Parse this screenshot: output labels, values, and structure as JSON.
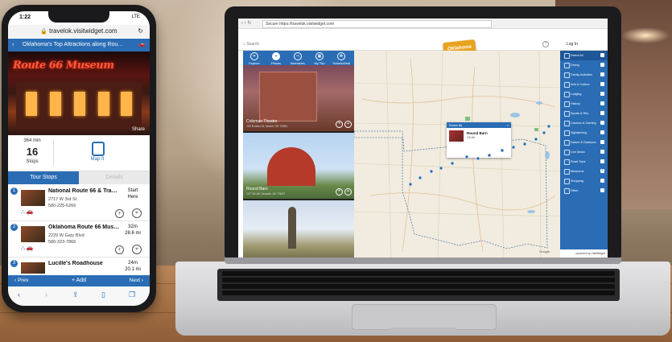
{
  "phone": {
    "status": {
      "time": "1:22",
      "network": "LTE"
    },
    "url": "travelok.visitwidget.com",
    "header_title": "Oklahoma's Top Attractions along Rou…",
    "hero_sign": "Route 66 Museum",
    "hero_share": "Share",
    "stats": {
      "minutes": "364 min",
      "stops_count": "16",
      "stops_label": "Stops",
      "map_label": "Map It"
    },
    "tabs": [
      "Tour Stops",
      "Details"
    ],
    "stops": [
      {
        "num": "1",
        "name": "National Route 66 & Tra…",
        "address": "2717 W 3rd St",
        "phone": "580-225-6266",
        "dist_a": "Start",
        "dist_b": "Here"
      },
      {
        "num": "2",
        "name": "Oklahoma Route 66 Mus…",
        "address": "2229 W Gary Blvd",
        "phone": "580-323-7866",
        "dist_a": "32m",
        "dist_b": "28.6 mi"
      },
      {
        "num": "3",
        "name": "Lucille's Roadhouse",
        "address": "",
        "phone": "",
        "dist_a": "24m",
        "dist_b": "20.1 mi"
      }
    ],
    "footer": {
      "prev": "Prev",
      "add": "Add",
      "next": "Next"
    }
  },
  "laptop": {
    "address": "Secure  https://travelok.visitwidget.com",
    "search_placeholder": "Search",
    "login": "Log In",
    "help": "?",
    "logo": "OKlahoma",
    "nav": [
      "Explore",
      "Places",
      "Itineraries",
      "My Trip",
      "Tickets/Deal"
    ],
    "cards": [
      {
        "name": "Coleman Theatre",
        "sub": "103 N Main St, Miami, OK 74354"
      },
      {
        "name": "Round Barn",
        "sub": "107 OK-66, Arcadia, OK 73007"
      },
      {
        "name": "",
        "sub": ""
      }
    ],
    "popup": {
      "header": "Route 66",
      "name": "Round Barn",
      "addr": "OK-66"
    },
    "categories": [
      "Select All",
      "Dining",
      "Family Activities",
      "Arts & Culture",
      "Lodging",
      "History",
      "Sports & Rec",
      "Casinos & Gaming",
      "Sightseeing",
      "Nature & Outdoors",
      "Live Music",
      "Road Trips",
      "Museums",
      "Shopping",
      "Other"
    ],
    "checked": [
      "Museums"
    ],
    "footer": "powered by VisitWidget"
  }
}
